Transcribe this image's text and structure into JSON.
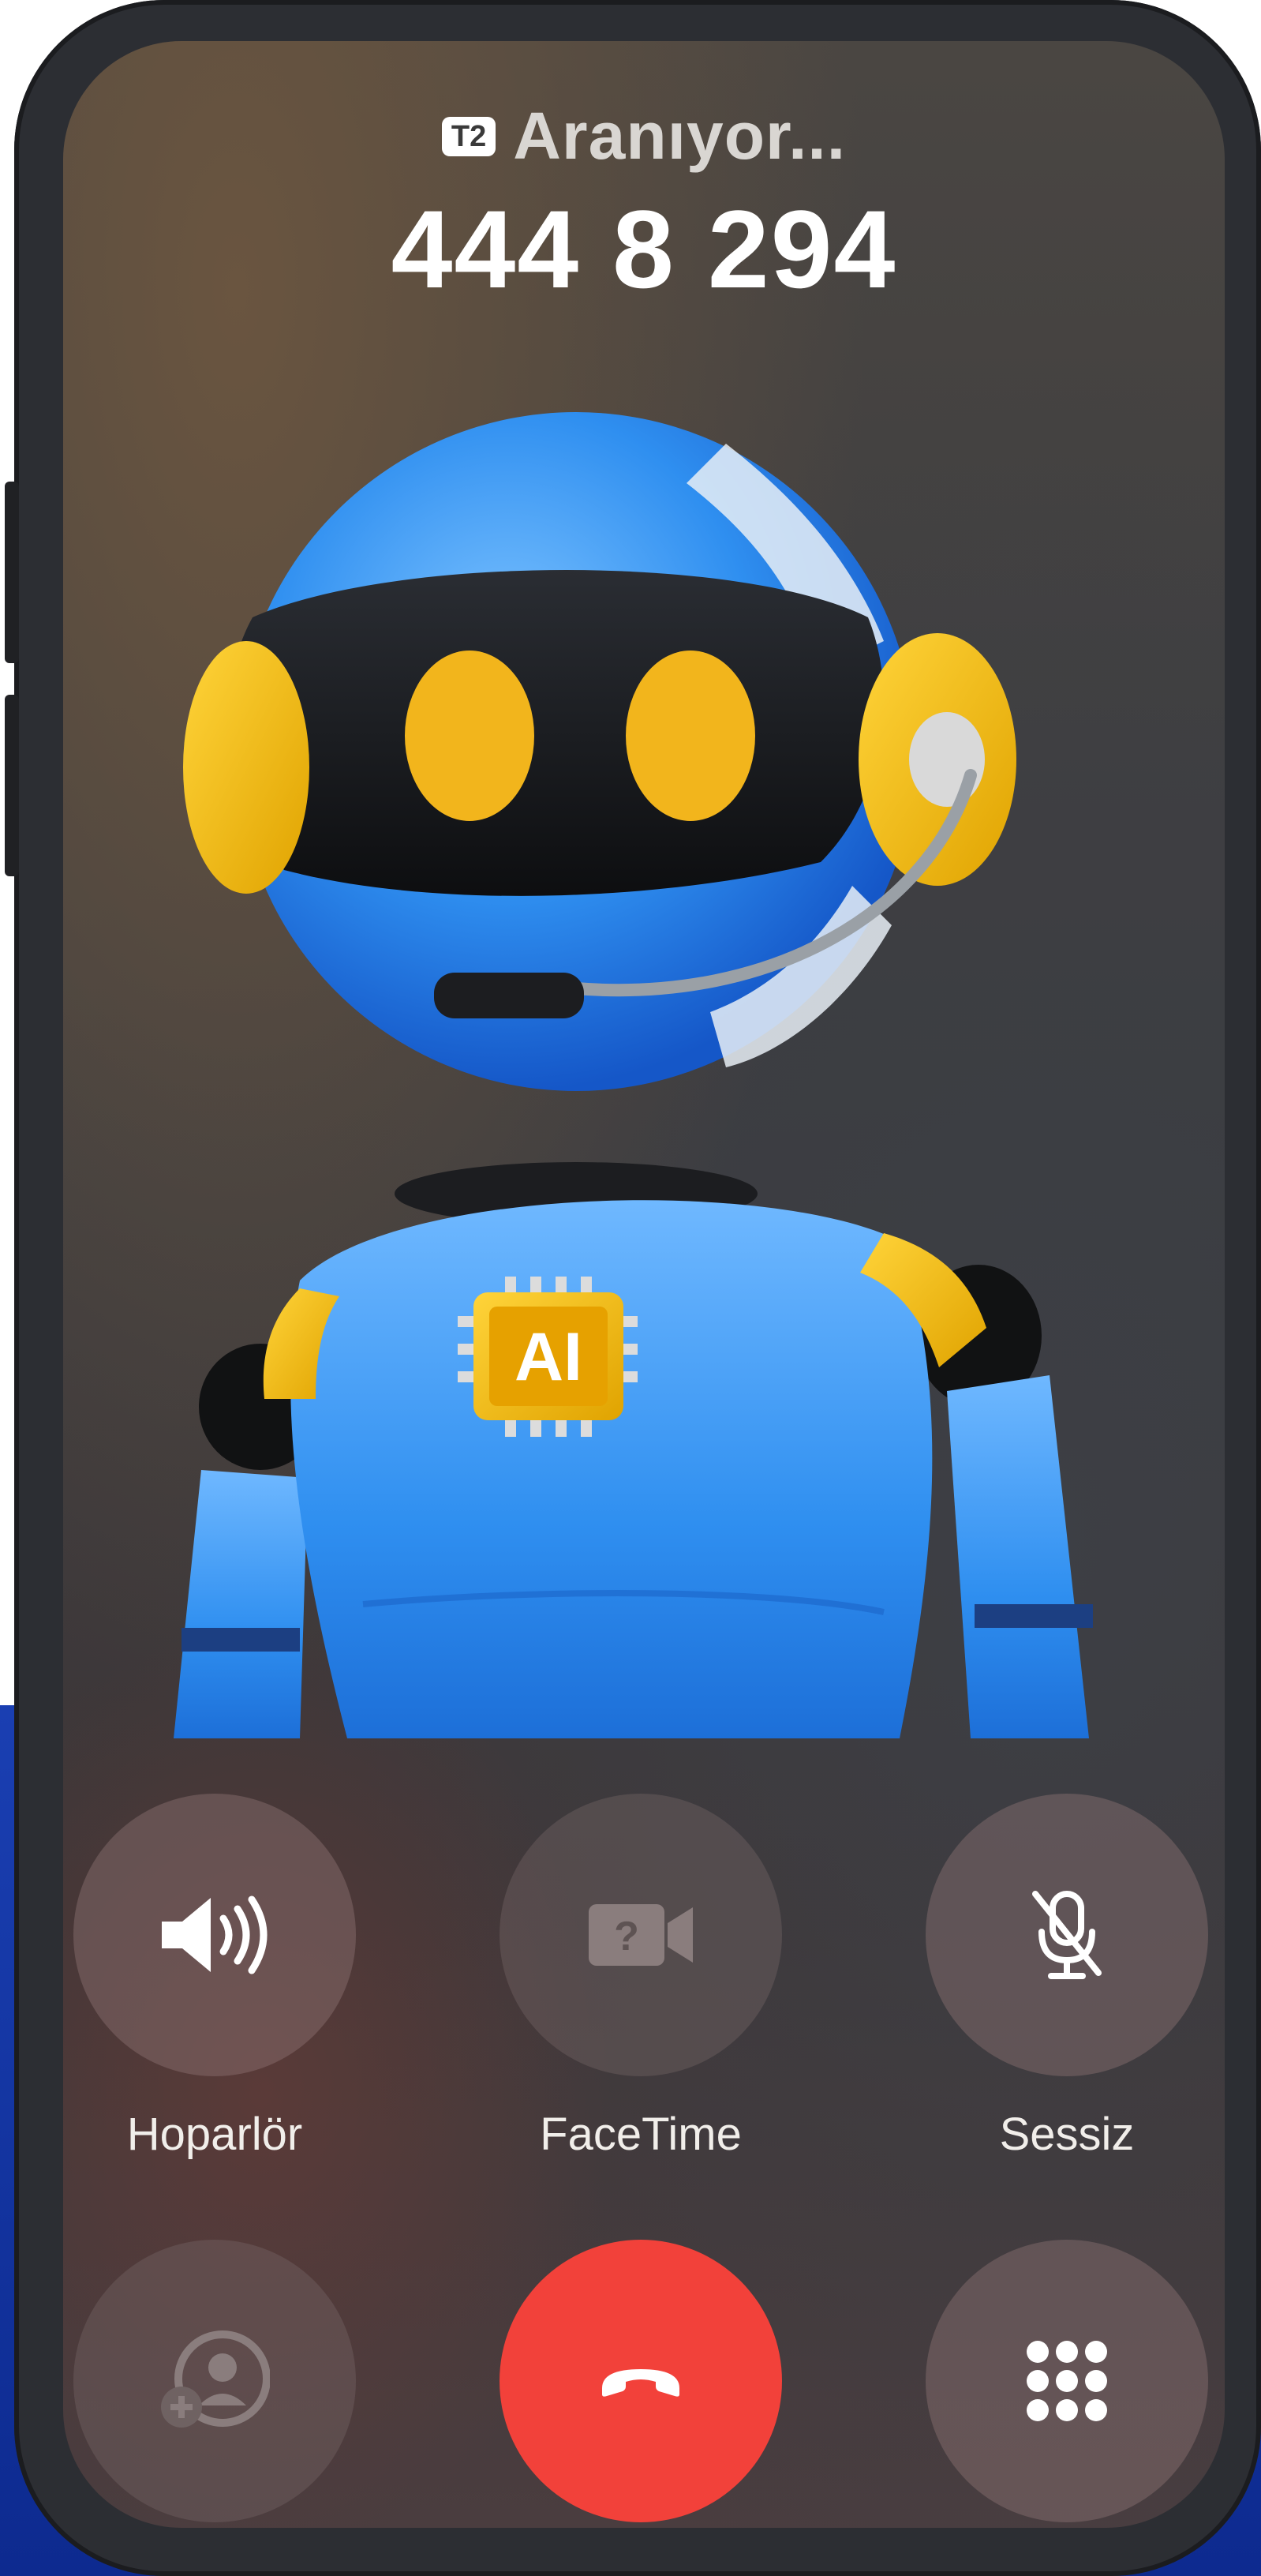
{
  "call": {
    "sim_label": "T2",
    "status": "Aranıyor...",
    "number": "444 8 294"
  },
  "robot": {
    "chip_text": "AI",
    "description_icon": "ai-robot-headset-avatar"
  },
  "controls": {
    "speaker": {
      "label": "Hoparlör",
      "icon": "speaker-icon",
      "enabled": true
    },
    "facetime": {
      "label": "FaceTime",
      "icon": "facetime-question-icon",
      "enabled": false
    },
    "mute": {
      "label": "Sessiz",
      "icon": "mic-slash-icon",
      "enabled": true
    },
    "add_call": {
      "icon": "add-person-icon",
      "enabled": false
    },
    "end_call": {
      "icon": "end-call-icon",
      "color": "#f2413a"
    },
    "keypad": {
      "icon": "keypad-icon",
      "enabled": true
    }
  }
}
